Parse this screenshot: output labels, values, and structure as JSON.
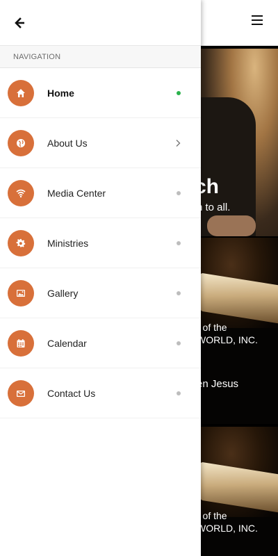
{
  "page": {
    "hero": {
      "title": "ch",
      "subtitle": "n to all."
    },
    "cards": [
      {
        "line1": "r of the",
        "line2": "WORLD, INC.",
        "line3": "en Jesus"
      },
      {
        "line1": "r of the",
        "line2": "WORLD, INC."
      }
    ],
    "menu_icon": "hamburger-icon"
  },
  "drawer": {
    "back_icon": "arrow-left-icon",
    "section_title": "NAVIGATION",
    "items": [
      {
        "label": "Home",
        "icon": "home-icon",
        "indicator": "dot",
        "active": true
      },
      {
        "label": "About Us",
        "icon": "globe-icon",
        "indicator": "chevron",
        "active": false
      },
      {
        "label": "Media Center",
        "icon": "wifi-icon",
        "indicator": "dot",
        "active": false
      },
      {
        "label": "Ministries",
        "icon": "gear-icon",
        "indicator": "dot",
        "active": false
      },
      {
        "label": "Gallery",
        "icon": "image-icon",
        "indicator": "dot",
        "active": false
      },
      {
        "label": "Calendar",
        "icon": "calendar-icon",
        "indicator": "dot",
        "active": false
      },
      {
        "label": "Contact Us",
        "icon": "envelope-icon",
        "indicator": "dot",
        "active": false
      }
    ]
  },
  "colors": {
    "icon_bg": "#d8703a",
    "active_dot": "#2bb24c",
    "inactive_dot": "#bdbdbd"
  }
}
